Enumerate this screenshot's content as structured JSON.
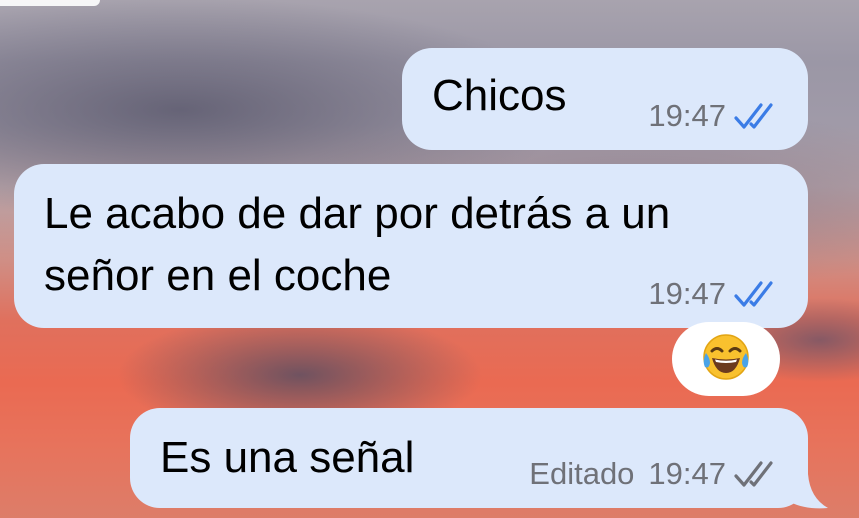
{
  "messages": [
    {
      "text": "Chicos",
      "time": "19:47",
      "status_icon": "double-check-read-icon",
      "status_color": "#3b7ce6"
    },
    {
      "text_line1": "Le acabo de dar por detrás a un",
      "text_line2": "señor en el coche",
      "time": "19:47",
      "status_icon": "double-check-read-icon",
      "status_color": "#3b7ce6"
    },
    {
      "text": "Es una señal",
      "edited_label": "Editado",
      "time": "19:47",
      "status_icon": "double-check-delivered-icon",
      "status_color": "#6f7178"
    }
  ],
  "reaction": {
    "emoji": "😂",
    "icon": "face-with-tears-of-joy-icon"
  },
  "colors": {
    "bubble": "#dce8fb",
    "read_check": "#3b7ce6",
    "meta_text": "#6f7178"
  }
}
